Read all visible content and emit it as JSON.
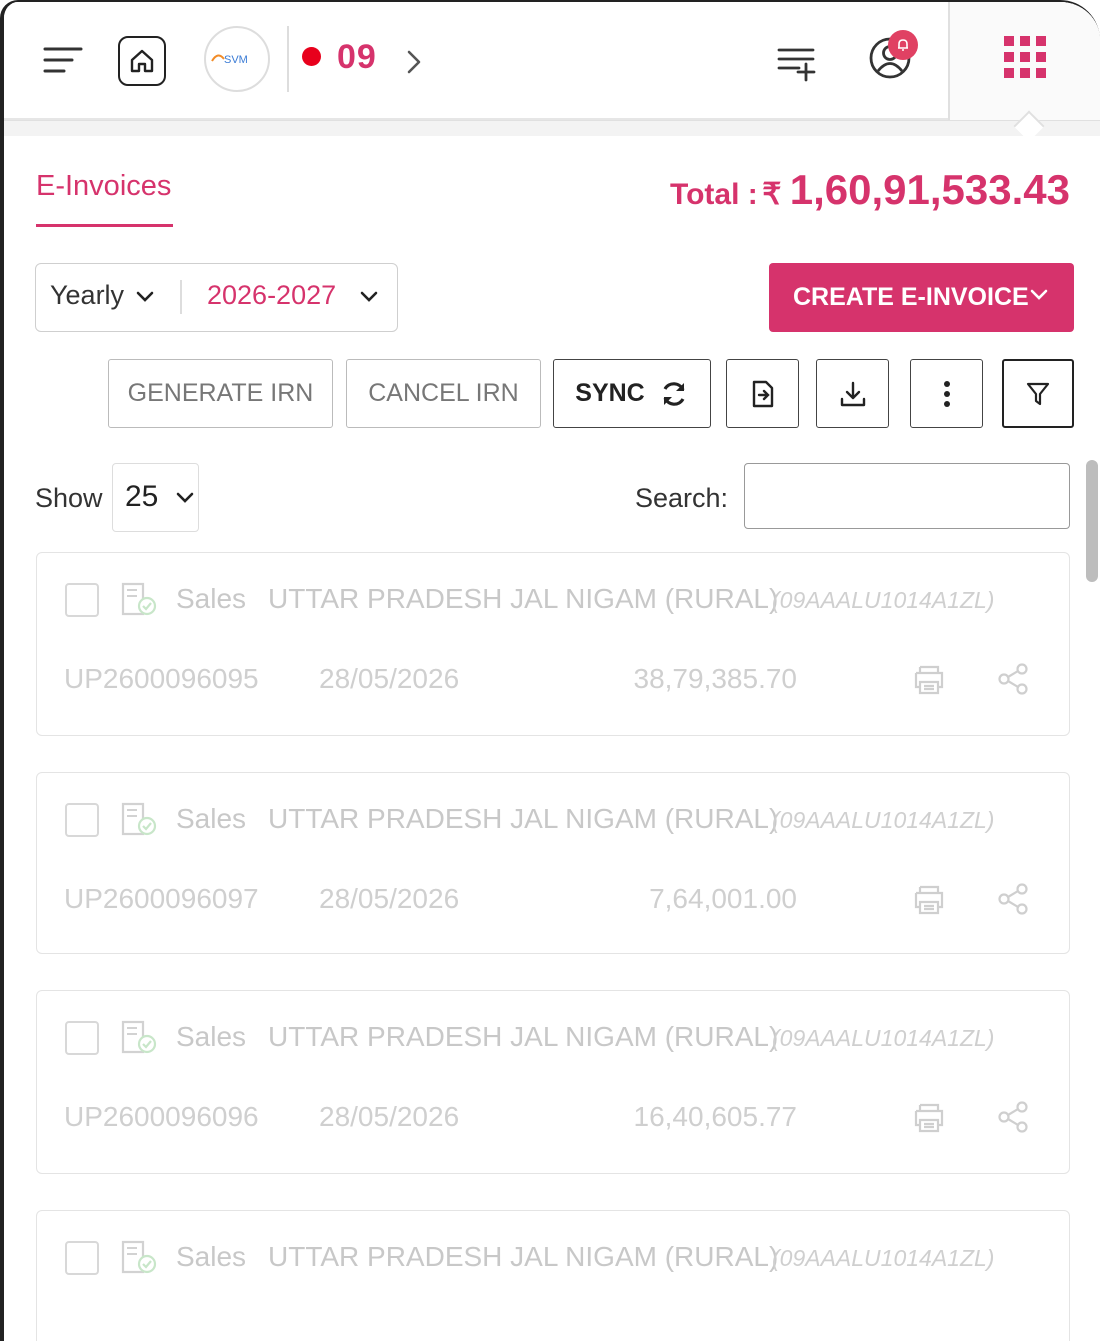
{
  "header": {
    "period_number": "09",
    "logo_text": "SVM",
    "colors": {
      "accent": "#d6336c",
      "status_dot": "#e8001c",
      "badge": "#e04163"
    }
  },
  "page": {
    "tab_label": "E-Invoices",
    "total_label": "Total :",
    "total_currency": "₹",
    "total_amount": "1,60,91,533.43"
  },
  "filters": {
    "period_type": "Yearly",
    "fiscal_year": "2026-2027",
    "create_button": "CREATE E-INVOICE"
  },
  "actions": {
    "generate_irn": "GENERATE IRN",
    "cancel_irn": "CANCEL IRN",
    "sync": "SYNC"
  },
  "table_controls": {
    "show_label": "Show",
    "page_size": "25",
    "search_label": "Search:",
    "search_value": ""
  },
  "invoices": [
    {
      "type": "Sales",
      "party": "UTTAR PRADESH JAL NIGAM (RURAL)",
      "gstin": "(09AAALU1014A1ZL)",
      "number": "UP2600096095",
      "date": "28/05/2026",
      "amount": "38,79,385.70"
    },
    {
      "type": "Sales",
      "party": "UTTAR PRADESH JAL NIGAM (RURAL)",
      "gstin": "(09AAALU1014A1ZL)",
      "number": "UP2600096097",
      "date": "28/05/2026",
      "amount": "7,64,001.00"
    },
    {
      "type": "Sales",
      "party": "UTTAR PRADESH JAL NIGAM (RURAL)",
      "gstin": "(09AAALU1014A1ZL)",
      "number": "UP2600096096",
      "date": "28/05/2026",
      "amount": "16,40,605.77"
    },
    {
      "type": "Sales",
      "party": "UTTAR PRADESH JAL NIGAM (RURAL)",
      "gstin": "(09AAALU1014A1ZL)",
      "number": "",
      "date": "",
      "amount": ""
    }
  ]
}
